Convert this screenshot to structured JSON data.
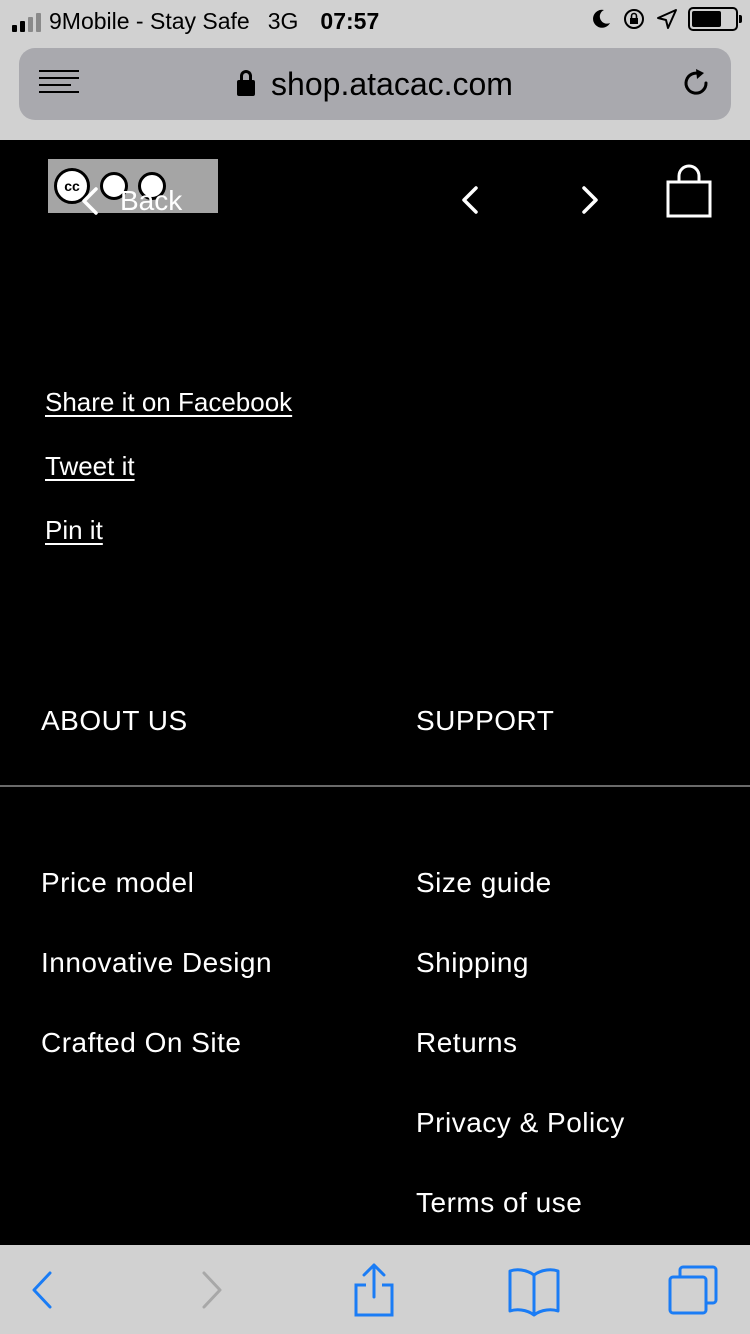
{
  "status_bar": {
    "carrier": "9Mobile - Stay Safe",
    "network": "3G",
    "time": "07:57"
  },
  "browser": {
    "url": "shop.atacac.com"
  },
  "header": {
    "back_label": "Back"
  },
  "share": {
    "facebook": "Share it on Facebook ",
    "twitter": "Tweet it ",
    "pinterest": "Pin it"
  },
  "footer": {
    "about": {
      "heading": "ABOUT US",
      "links": [
        "Price model",
        "Innovative Design",
        "Crafted On Site"
      ]
    },
    "support": {
      "heading": "SUPPORT",
      "links": [
        "Size guide",
        "Shipping",
        "Returns",
        "Privacy & Policy",
        "Terms of use"
      ]
    }
  },
  "colors": {
    "page_background": "#000000",
    "system_chrome": "#d1d1d1",
    "toolbar_active": "#1a7cf5",
    "toolbar_disabled": "#a8a8a8"
  }
}
